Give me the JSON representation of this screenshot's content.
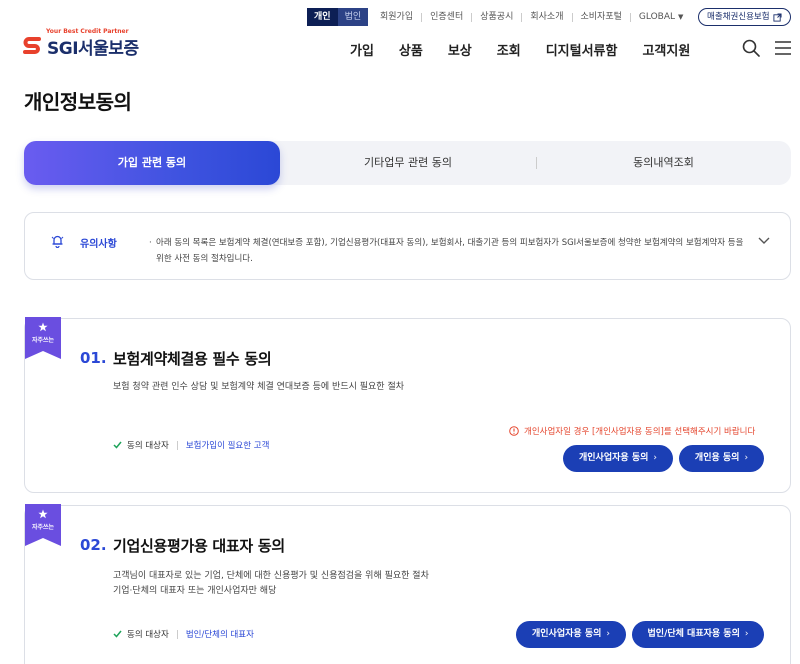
{
  "utility": {
    "seg_personal": "개인",
    "seg_corporate": "법인",
    "links": [
      "회원가입",
      "인증센터",
      "상품공시",
      "회사소개",
      "소비자포털",
      "GLOBAL"
    ],
    "bond_button": "매출채권신용보험"
  },
  "logo": {
    "tagline": "Your Best Credit Partner",
    "name": "SGI서울보증"
  },
  "nav": [
    "가입",
    "상품",
    "보상",
    "조회",
    "디지털서류함",
    "고객지원"
  ],
  "page_title": "개인정보동의",
  "tabs": [
    "가입 관련 동의",
    "기타업무 관련 동의",
    "동의내역조회"
  ],
  "notice": {
    "label": "유의사항",
    "text": "아래 동의 목록은 보험계약 체결(연대보증 포함), 기업신용평가(대표자 동의), 보험회사, 대출기관 등의 피보험자가 SGI서울보증에 청약한 보험계약의 보험계약자 등을 위한 사전 동의 절차입니다."
  },
  "cards": [
    {
      "ribbon": "자주쓰는",
      "num": "01.",
      "title": "보험계약체결용 필수 동의",
      "desc1": "보험 청약 관련 인수 상담 및 보험계약 체결 연대보증 등에 반드시 필요한 절차",
      "desc2": "",
      "target_label": "동의 대상자",
      "target_value": "보험가입이 필요한 고객",
      "warning": "개인사업자일 경우 [개인사업자용 동의]를 선택해주시기 바랍니다",
      "btn1": "개인사업자용 동의",
      "btn2": "개인용 동의"
    },
    {
      "ribbon": "자주쓰는",
      "num": "02.",
      "title": "기업신용평가용 대표자 동의",
      "desc1": "고객님이 대표자로 있는 기업, 단체에 대한 신용평가 및 신용점검을 위해 필요한 절차",
      "desc2": "기업·단체의 대표자 또는 개인사업자만 해당",
      "target_label": "동의 대상자",
      "target_value": "법인/단체의 대표자",
      "btn1": "개인사업자용 동의",
      "btn2": "법인/단체 대표자용 동의"
    }
  ],
  "colors": {
    "brand_navy": "#1b2f6b",
    "accent_blue": "#2b48d6",
    "button_blue": "#1b3fb5",
    "ribbon_purple": "#6a4ee0",
    "warning_red": "#e5472f"
  }
}
